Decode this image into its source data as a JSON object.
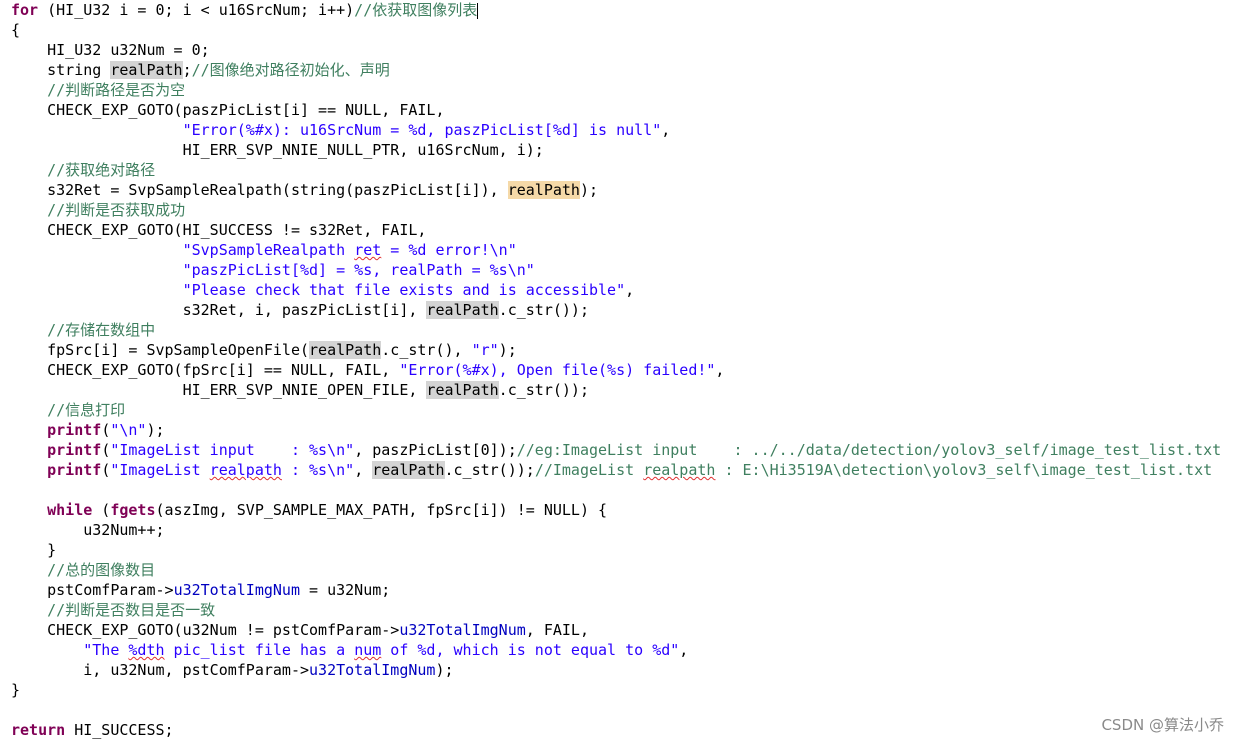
{
  "code_lines": [
    {
      "tokens": [
        {
          "t": "for",
          "c": "kw"
        },
        {
          "t": " (HI_U32 i = 0; i < u16SrcNum; i++)"
        },
        {
          "t": "//依获取图像列表",
          "c": "cm"
        }
      ],
      "caret": true
    },
    {
      "tokens": [
        {
          "t": "{"
        }
      ]
    },
    {
      "tokens": [
        {
          "t": "    HI_U32 u32Num = 0;"
        }
      ]
    },
    {
      "tokens": [
        {
          "t": "    string "
        },
        {
          "t": "realPath",
          "c": "hl"
        },
        {
          "t": ";"
        },
        {
          "t": "//图像绝对路径初始化、声明",
          "c": "cm"
        }
      ]
    },
    {
      "tokens": [
        {
          "t": "    //判断路径是否为空",
          "c": "cm"
        }
      ]
    },
    {
      "tokens": [
        {
          "t": "    CHECK_EXP_GOTO(paszPicList[i] == NULL, FAIL,"
        }
      ]
    },
    {
      "tokens": [
        {
          "t": "                   "
        },
        {
          "t": "\"Error(%#x): u16SrcNum = %d, paszPicList[%d] is null\"",
          "c": "str"
        },
        {
          "t": ","
        }
      ]
    },
    {
      "tokens": [
        {
          "t": "                   HI_ERR_SVP_NNIE_NULL_PTR, u16SrcNum, i);"
        }
      ]
    },
    {
      "tokens": [
        {
          "t": "    //获取绝对路径",
          "c": "cm"
        }
      ]
    },
    {
      "tokens": [
        {
          "t": "    s32Ret = SvpSampleRealpath(string(paszPicList[i]), "
        },
        {
          "t": "realPath",
          "c": "hl-sel"
        },
        {
          "t": ");"
        }
      ]
    },
    {
      "tokens": [
        {
          "t": "    //判断是否获取成功",
          "c": "cm"
        }
      ]
    },
    {
      "tokens": [
        {
          "t": "    CHECK_EXP_GOTO(HI_SUCCESS != s32Ret, FAIL,"
        }
      ]
    },
    {
      "tokens": [
        {
          "t": "                   "
        },
        {
          "t": "\"SvpSampleRealpath ",
          "c": "str"
        },
        {
          "t": "ret",
          "c": "str spell"
        },
        {
          "t": " = %d error!\\n\"",
          "c": "str"
        }
      ]
    },
    {
      "tokens": [
        {
          "t": "                   "
        },
        {
          "t": "\"paszPicList[%d] = %s, realPath = %s\\n\"",
          "c": "str"
        }
      ]
    },
    {
      "tokens": [
        {
          "t": "                   "
        },
        {
          "t": "\"Please check that file exists and is accessible\"",
          "c": "str"
        },
        {
          "t": ","
        }
      ]
    },
    {
      "tokens": [
        {
          "t": "                   s32Ret, i, paszPicList[i], "
        },
        {
          "t": "realPath",
          "c": "hl"
        },
        {
          "t": ".c_str());"
        }
      ]
    },
    {
      "tokens": [
        {
          "t": "    //存储在数组中",
          "c": "cm"
        }
      ]
    },
    {
      "tokens": [
        {
          "t": "    fpSrc[i] = SvpSampleOpenFile("
        },
        {
          "t": "realPath",
          "c": "hl"
        },
        {
          "t": ".c_str(), "
        },
        {
          "t": "\"r\"",
          "c": "str"
        },
        {
          "t": ");"
        }
      ]
    },
    {
      "tokens": [
        {
          "t": "    CHECK_EXP_GOTO(fpSrc[i] == NULL, FAIL, "
        },
        {
          "t": "\"Error(%#x), Open file(%s) failed!\"",
          "c": "str"
        },
        {
          "t": ","
        }
      ]
    },
    {
      "tokens": [
        {
          "t": "                   HI_ERR_SVP_NNIE_OPEN_FILE, "
        },
        {
          "t": "realPath",
          "c": "hl"
        },
        {
          "t": ".c_str());"
        }
      ]
    },
    {
      "tokens": [
        {
          "t": "    //信息打印",
          "c": "cm"
        }
      ]
    },
    {
      "tokens": [
        {
          "t": "    "
        },
        {
          "t": "printf",
          "c": "kw"
        },
        {
          "t": "("
        },
        {
          "t": "\"\\n\"",
          "c": "str"
        },
        {
          "t": ");"
        }
      ]
    },
    {
      "tokens": [
        {
          "t": "    "
        },
        {
          "t": "printf",
          "c": "kw"
        },
        {
          "t": "("
        },
        {
          "t": "\"ImageList input    : %s\\n\"",
          "c": "str"
        },
        {
          "t": ", paszPicList[0]);"
        },
        {
          "t": "//eg:ImageList input    : ../../data/detection/yolov3_self/image_test_list.txt",
          "c": "cm"
        }
      ]
    },
    {
      "tokens": [
        {
          "t": "    "
        },
        {
          "t": "printf",
          "c": "kw"
        },
        {
          "t": "("
        },
        {
          "t": "\"ImageList ",
          "c": "str"
        },
        {
          "t": "realpath",
          "c": "str spell"
        },
        {
          "t": " : %s\\n\"",
          "c": "str"
        },
        {
          "t": ", "
        },
        {
          "t": "realPath",
          "c": "hl"
        },
        {
          "t": ".c_str());"
        },
        {
          "t": "//ImageList ",
          "c": "cm"
        },
        {
          "t": "realpath",
          "c": "cm spell"
        },
        {
          "t": " : E:\\Hi3519A\\detection\\yolov3_self\\image_test_list.txt",
          "c": "cm"
        }
      ]
    },
    {
      "tokens": [
        {
          "t": ""
        }
      ]
    },
    {
      "tokens": [
        {
          "t": "    "
        },
        {
          "t": "while",
          "c": "kw"
        },
        {
          "t": " ("
        },
        {
          "t": "fgets",
          "c": "kw"
        },
        {
          "t": "(aszImg, SVP_SAMPLE_MAX_PATH, fpSrc[i]) != NULL) {"
        }
      ]
    },
    {
      "tokens": [
        {
          "t": "        u32Num++;"
        }
      ]
    },
    {
      "tokens": [
        {
          "t": "    }"
        }
      ]
    },
    {
      "tokens": [
        {
          "t": "    //总的图像数目",
          "c": "cm"
        }
      ]
    },
    {
      "tokens": [
        {
          "t": "    pstComfParam->"
        },
        {
          "t": "u32TotalImgNum",
          "c": "fld"
        },
        {
          "t": " = u32Num;"
        }
      ]
    },
    {
      "tokens": [
        {
          "t": "    //判断是否数目是否一致",
          "c": "cm"
        }
      ]
    },
    {
      "tokens": [
        {
          "t": "    CHECK_EXP_GOTO(u32Num != pstComfParam->"
        },
        {
          "t": "u32TotalImgNum",
          "c": "fld"
        },
        {
          "t": ", FAIL,"
        }
      ]
    },
    {
      "tokens": [
        {
          "t": "        "
        },
        {
          "t": "\"The ",
          "c": "str"
        },
        {
          "t": "%dth",
          "c": "str spell"
        },
        {
          "t": " pic_list file has a ",
          "c": "str"
        },
        {
          "t": "num",
          "c": "str spell"
        },
        {
          "t": " of %d, which is not equal to %d\"",
          "c": "str"
        },
        {
          "t": ","
        }
      ]
    },
    {
      "tokens": [
        {
          "t": "        i, u32Num, pstComfParam->"
        },
        {
          "t": "u32TotalImgNum",
          "c": "fld"
        },
        {
          "t": ");"
        }
      ]
    },
    {
      "tokens": [
        {
          "t": "}"
        }
      ]
    },
    {
      "tokens": [
        {
          "t": ""
        }
      ]
    },
    {
      "tokens": [
        {
          "t": "return",
          "c": "kw"
        },
        {
          "t": " HI_SUCCESS;"
        }
      ]
    }
  ],
  "watermark": "CSDN @算法小乔"
}
